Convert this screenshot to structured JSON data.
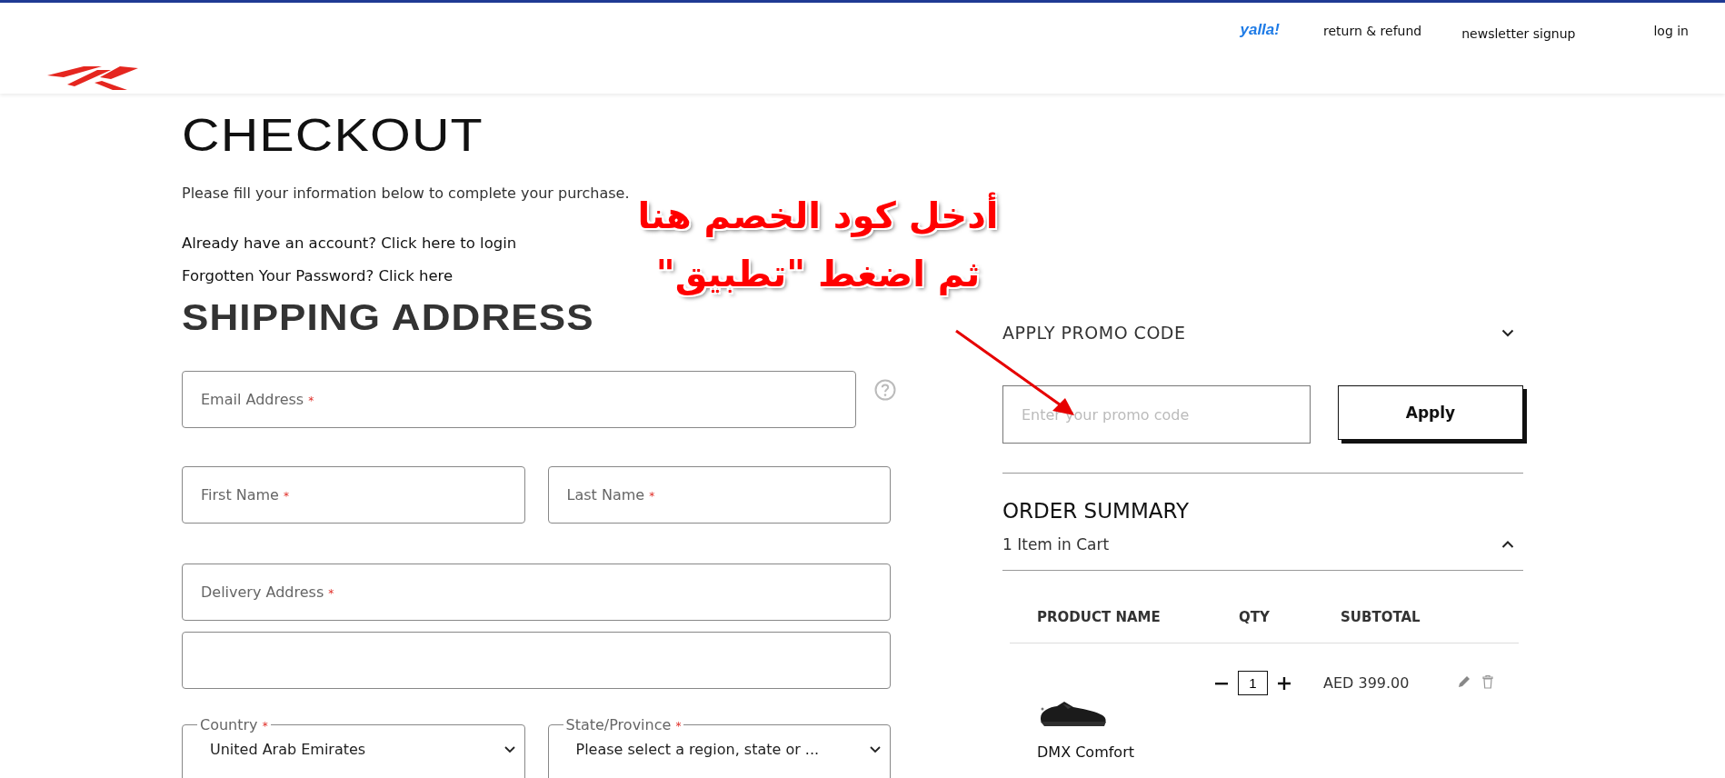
{
  "header": {
    "partner_logo": "yalla!",
    "nav": [
      "return & refund",
      "newsletter signup",
      "log in"
    ]
  },
  "checkout": {
    "title": "CHECKOUT",
    "subtitle": "Please fill your information below to complete your purchase.",
    "links": [
      "Already have an account? Click here to login",
      "Forgotten Your Password? Click here"
    ]
  },
  "shipping": {
    "title": "SHIPPING ADDRESS",
    "rows": [
      {
        "fields": [
          {
            "kind": "text",
            "label": "Email Address",
            "required_mark": "*",
            "help": true
          }
        ]
      },
      {
        "fields": [
          {
            "kind": "text",
            "label": "First Name",
            "required_mark": "*"
          },
          {
            "kind": "text",
            "label": "Last Name",
            "required_mark": "*"
          }
        ]
      },
      {
        "fields": [
          {
            "kind": "text",
            "label": "Delivery Address",
            "required_mark": "*"
          }
        ]
      },
      {
        "fields": [
          {
            "kind": "text"
          }
        ]
      },
      {
        "fields": [
          {
            "kind": "select",
            "label": "Country",
            "required_mark": "*",
            "value": "United Arab Emirates"
          },
          {
            "kind": "select",
            "label": "State/Province",
            "required_mark": "*",
            "value": "Please select a region, state or ..."
          }
        ]
      }
    ]
  },
  "promo": {
    "title": "APPLY PROMO CODE",
    "expanded": true,
    "placeholder": "Enter your promo code",
    "button": "Apply"
  },
  "summary": {
    "title": "ORDER SUMMARY",
    "cart_count": "1 Item in Cart",
    "expanded": true,
    "columns": [
      "PRODUCT NAME",
      "QTY",
      "SUBTOTAL"
    ],
    "items": [
      {
        "name": "DMX Comfort",
        "qty": "1",
        "subtotal": "AED 399.00"
      }
    ]
  },
  "annotation": {
    "lines": [
      "أدخل كود الخصم هنا",
      "ثم اضغط \"تطبيق\""
    ]
  }
}
